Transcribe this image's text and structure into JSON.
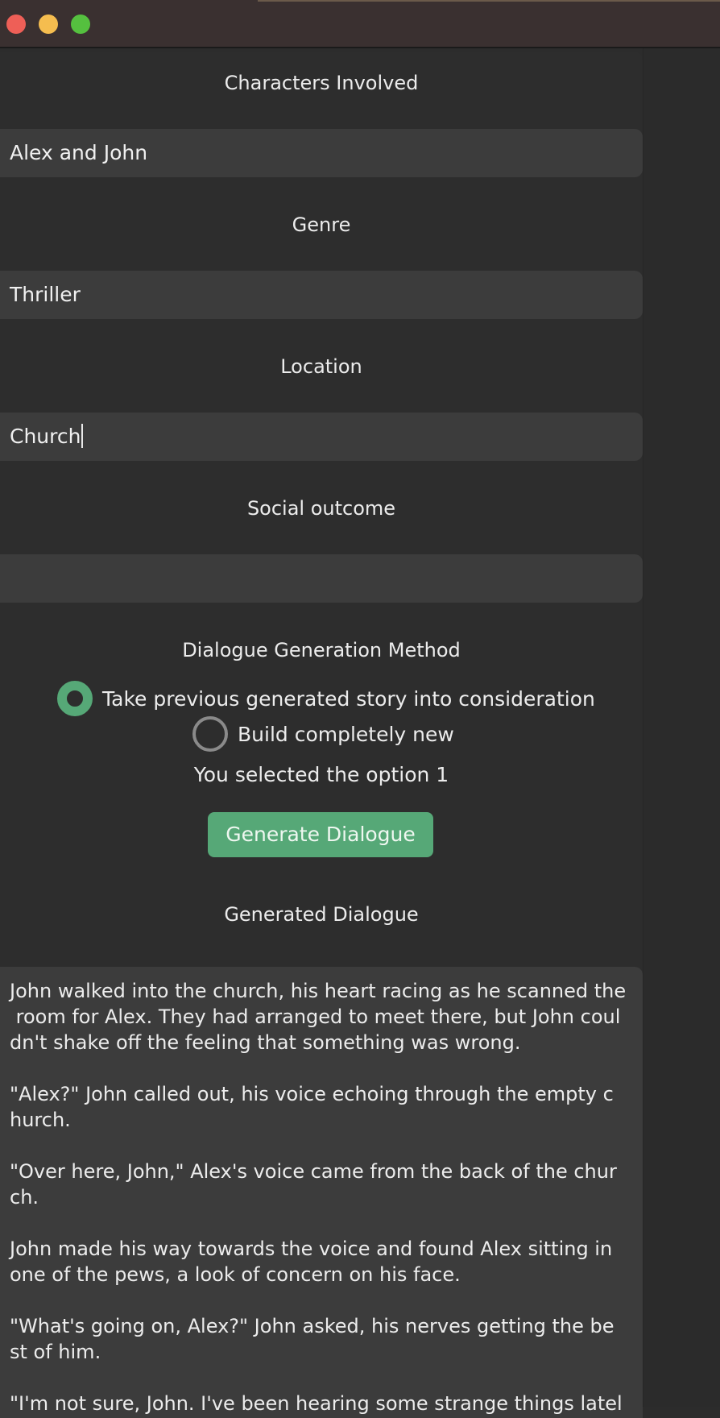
{
  "window": {
    "controls": [
      "close-button",
      "minimize-button",
      "maximize-button"
    ]
  },
  "form": {
    "characters_label": "Characters Involved",
    "characters_value": "Alex and John",
    "genre_label": "Genre",
    "genre_value": "Thriller",
    "location_label": "Location",
    "location_value": "Church",
    "social_label": "Social outcome",
    "social_value": "",
    "method_label": "Dialogue Generation Method",
    "option1_label": "Take previous generated story into consideration",
    "option2_label": "Build completely new",
    "selected_text": "You selected the option 1",
    "generate_button": "Generate Dialogue",
    "output_label": "Generated Dialogue"
  },
  "colors": {
    "accent": "#56a877",
    "field_bg": "#3c3c3c",
    "panel_bg": "#2d2d2d"
  },
  "dialogue": [
    "John walked into the church, his heart racing as he scanned the\n room for Alex. They had arranged to meet there, but John coul\ndn't shake off the feeling that something was wrong.",
    "\"Alex?\" John called out, his voice echoing through the empty c\nhurch.",
    "\"Over here, John,\" Alex's voice came from the back of the chur\nch.",
    "John made his way towards the voice and found Alex sitting in\none of the pews, a look of concern on his face.",
    "\"What's going on, Alex?\" John asked, his nerves getting the be\nst of him.",
    "\"I'm not sure, John. I've been hearing some strange things latel"
  ]
}
